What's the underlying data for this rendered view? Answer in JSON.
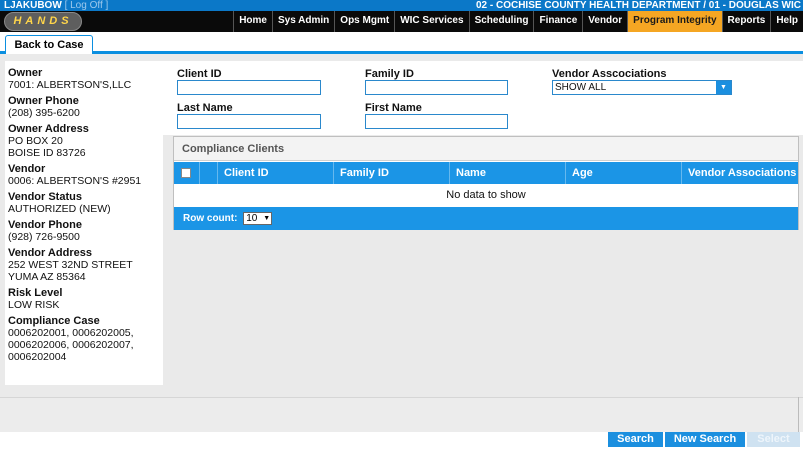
{
  "header": {
    "user": "LJAKUBOW",
    "logoff": "Log Off",
    "org": "02 - COCHISE COUNTY HEALTH DEPARTMENT / 01 - DOUGLAS WIC",
    "logo_text": "HANDS"
  },
  "nav": {
    "items": [
      "Home",
      "Sys Admin",
      "Ops Mgmt",
      "WIC Services",
      "Scheduling",
      "Finance",
      "Vendor",
      "Program Integrity",
      "Reports",
      "Help"
    ],
    "active": "Program Integrity"
  },
  "tabs": {
    "back_to_case": "Back to Case"
  },
  "owner_panel": {
    "owner_label": "Owner",
    "owner_value": "7001: ALBERTSON'S,LLC",
    "owner_phone_label": "Owner Phone",
    "owner_phone_value": "(208) 395-6200",
    "owner_address_label": "Owner Address",
    "owner_address_line1": "PO BOX 20",
    "owner_address_line2": "BOISE ID 83726",
    "vendor_label": "Vendor",
    "vendor_value": "0006: ALBERTSON'S #2951",
    "vendor_status_label": "Vendor Status",
    "vendor_status_value": "AUTHORIZED (NEW)",
    "vendor_phone_label": "Vendor Phone",
    "vendor_phone_value": "(928) 726-9500",
    "vendor_address_label": "Vendor Address",
    "vendor_address_line1": "252 WEST 32ND STREET",
    "vendor_address_line2": "YUMA AZ 85364",
    "risk_level_label": "Risk Level",
    "risk_level_value": "LOW RISK",
    "compliance_case_label": "Compliance Case",
    "compliance_case_line1": "0006202001, 0006202005,",
    "compliance_case_line2": "0006202006, 0006202007,",
    "compliance_case_line3": "0006202004"
  },
  "search_form": {
    "client_id_label": "Client ID",
    "client_id_value": "",
    "family_id_label": "Family ID",
    "family_id_value": "",
    "vendor_assoc_label": "Vendor Asscociations",
    "vendor_assoc_value": "SHOW ALL",
    "last_name_label": "Last Name",
    "last_name_value": "",
    "first_name_label": "First Name",
    "first_name_value": ""
  },
  "grid": {
    "caption": "Compliance Clients",
    "columns": [
      "Client ID",
      "Family ID",
      "Name",
      "Age",
      "Vendor Associations"
    ],
    "empty_text": "No data to show",
    "row_count_label": "Row count:",
    "row_count_value": "10"
  },
  "actions": {
    "search": "Search",
    "new_search": "New Search",
    "select": "Select"
  }
}
